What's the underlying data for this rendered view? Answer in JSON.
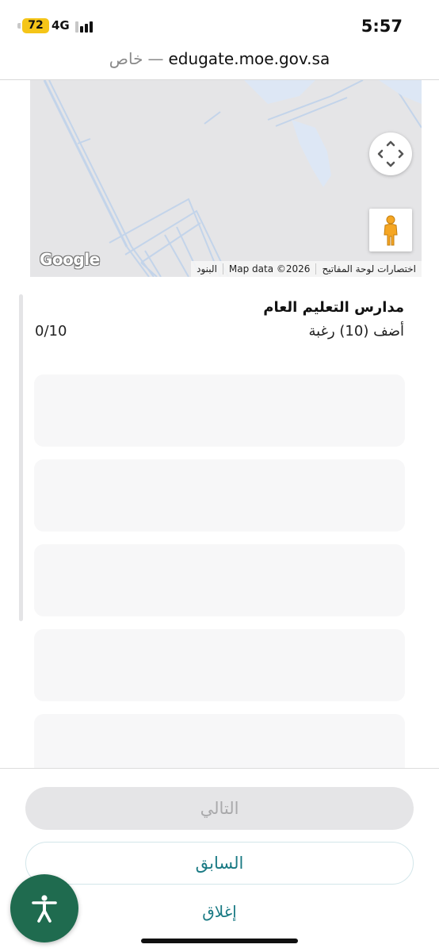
{
  "status_bar": {
    "battery": "72",
    "network": "4G",
    "time": "5:57",
    "accent_color": "#f5c518"
  },
  "browser": {
    "private_label": "خاص",
    "separator": "—",
    "domain": "edugate.moe.gov.sa"
  },
  "map": {
    "logo": "Google",
    "attribution": {
      "shortcuts": "اختصارات لوحة المفاتيح",
      "map_data": "Map data ©2026",
      "terms": "البنود"
    },
    "controls": [
      "move-icon",
      "pegman-icon"
    ]
  },
  "section": {
    "title": "مدارس التعليم العام",
    "subtitle": "أضف (10) رغبة",
    "counter": "0/10"
  },
  "footer": {
    "next_label": "التالي",
    "previous_label": "السابق",
    "close_label": "إغلاق",
    "accent_color": "#1a7a84"
  },
  "accessibility": {
    "icon": "accessibility-icon",
    "color": "#1f6b4f"
  }
}
